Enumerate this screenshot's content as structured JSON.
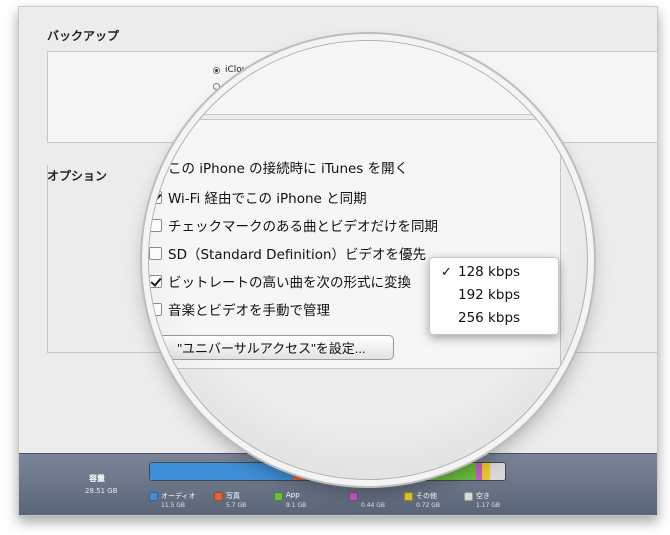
{
  "backup": {
    "title": "バックアップ",
    "icloud_label": "iCloud"
  },
  "options": {
    "title": "オプション",
    "items": [
      {
        "label": "この iPhone の接続時に iTunes を開く",
        "checked": false
      },
      {
        "label": "Wi-Fi 経由でこの iPhone と同期",
        "checked": true
      },
      {
        "label": "チェックマークのある曲とビデオだけを同期",
        "checked": false
      },
      {
        "label": "SD（Standard Definition）ビデオを優先",
        "checked": false
      },
      {
        "label": "ビットレートの高い曲を次の形式に変換",
        "checked": true
      },
      {
        "label": "音楽とビデオを手動で管理",
        "checked": false
      }
    ],
    "accessibility_button": "\"ユニバーサルアクセス\"を設定..."
  },
  "bitrate_menu": {
    "selected_mark": "✓",
    "options": [
      "128 kbps",
      "192 kbps",
      "256 kbps"
    ],
    "selected_index": 0
  },
  "storage": {
    "capacity_label": "容量",
    "capacity_value": "28.51 GB",
    "legend": [
      {
        "name": "オーディオ",
        "value": "11.5 GB",
        "color": "#3f8fd8"
      },
      {
        "name": "写真",
        "value": "5.7 GB",
        "color": "#e0663a"
      },
      {
        "name": "App",
        "value": "9.1 GB",
        "color": "#6bbd3f"
      },
      {
        "name": "",
        "value": "0.44 GB",
        "color": "#c45ec6"
      },
      {
        "name": "その他",
        "value": "0.72 GB",
        "color": "#e9c82c"
      },
      {
        "name": "空き",
        "value": "1.17 GB",
        "color": "#d8d8d8"
      }
    ]
  }
}
